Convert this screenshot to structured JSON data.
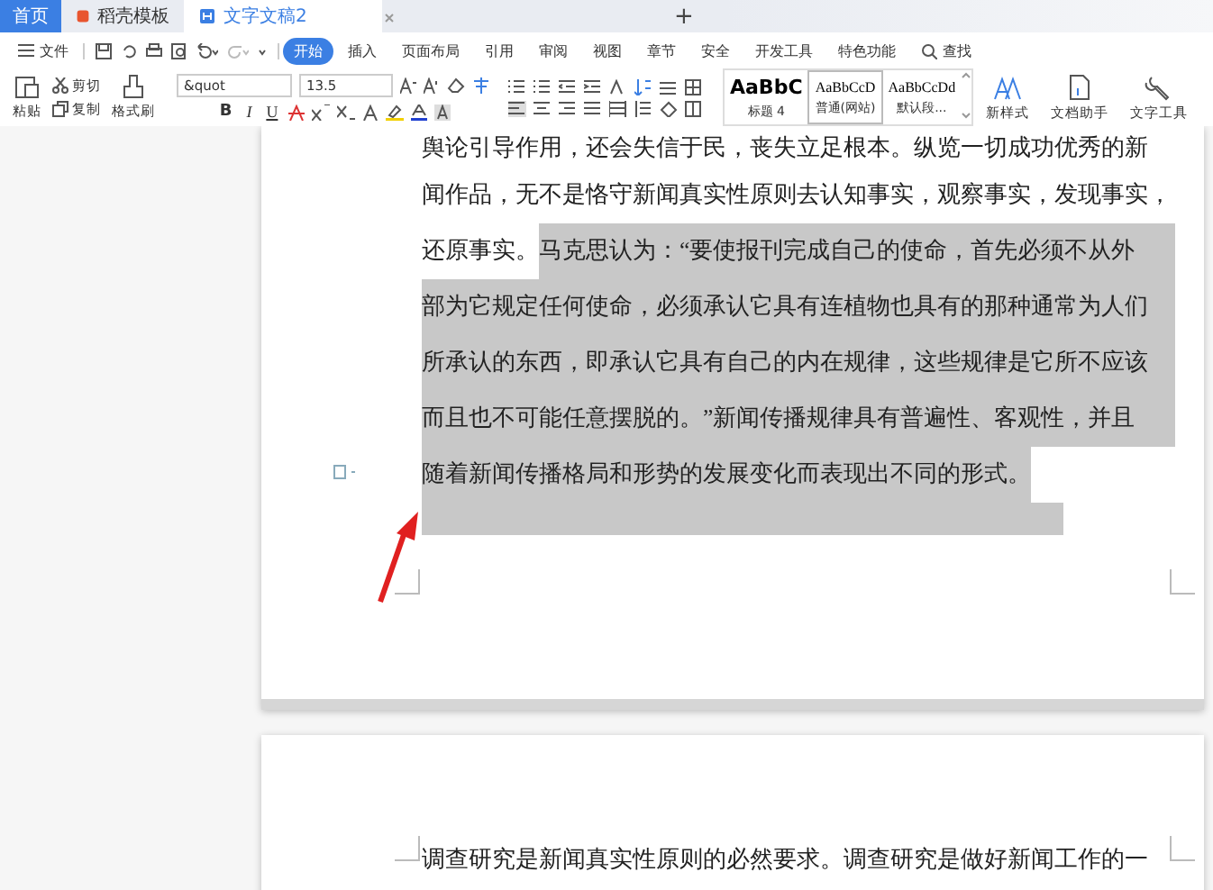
{
  "tabs": [
    {
      "label": "首页",
      "kind": "home",
      "selected": false
    },
    {
      "label": "稻壳模板",
      "kind": "template",
      "selected": false
    },
    {
      "label": "文字文稿2",
      "kind": "document",
      "selected": true
    }
  ],
  "new_tab": "+",
  "menu": [
    {
      "label": "文件",
      "kind": "file",
      "selected": false
    },
    {
      "label": "开始",
      "kind": "tab",
      "selected": true
    },
    {
      "label": "插入",
      "kind": "tab",
      "selected": false
    },
    {
      "label": "页面布局",
      "kind": "tab",
      "selected": false
    },
    {
      "label": "引用",
      "kind": "tab",
      "selected": false
    },
    {
      "label": "审阅",
      "kind": "tab",
      "selected": false
    },
    {
      "label": "视图",
      "kind": "tab",
      "selected": false
    },
    {
      "label": "章节",
      "kind": "tab",
      "selected": false
    },
    {
      "label": "安全",
      "kind": "tab",
      "selected": false
    },
    {
      "label": "开发工具",
      "kind": "tab",
      "selected": false
    },
    {
      "label": "特色功能",
      "kind": "tab",
      "selected": false
    },
    {
      "label": "查找",
      "kind": "search",
      "selected": false
    }
  ],
  "clipboard": {
    "paste": "粘贴",
    "cut": "剪切",
    "copy": "复制",
    "format_painter": "格式刷"
  },
  "font": {
    "name": "&quot",
    "size": "13.5",
    "bold": "B",
    "italic": "I",
    "underline": "U"
  },
  "styles": [
    {
      "sample": "AaBbC",
      "label": "标题 4",
      "kind": "heading"
    },
    {
      "sample": "AaBbCcD",
      "label": "普通(网站)",
      "kind": "normal"
    },
    {
      "sample": "AaBbCcDd",
      "label": "默认段...",
      "kind": "default"
    }
  ],
  "tools": [
    {
      "label": "新样式",
      "kind": "new-style"
    },
    {
      "label": "文档助手",
      "kind": "assistant"
    },
    {
      "label": "文字工具",
      "kind": "text-tools"
    }
  ],
  "page_1": {
    "lines": [
      {
        "segments": [
          {
            "text": "舆论引导作用，还会失信于民，丧失立足根本。纵览一切成功优秀的新",
            "selected": false
          }
        ]
      },
      {
        "segments": [
          {
            "text": "闻作品，无不是恪守新闻真实性原则去认知事实，观察事实，发现事实，",
            "selected": false
          }
        ]
      },
      {
        "segments": [
          {
            "text": "还原事实。",
            "selected": false
          },
          {
            "text": "马克思认为：“要使报刊完成自己的使命，首先必须不从外",
            "selected": true
          }
        ]
      },
      {
        "segments": [
          {
            "text": "部为它规定任何使命，必须承认它具有连植物也具有的那种通常为人们",
            "selected": true
          }
        ]
      },
      {
        "segments": [
          {
            "text": "所承认的东西，即承认它具有自己的内在规律，这些规律是它所不应该",
            "selected": true
          }
        ]
      },
      {
        "segments": [
          {
            "text": "而且也不可能任意摆脱的。”新闻传播规律具有普遍性、客观性，并且",
            "selected": true
          }
        ]
      },
      {
        "segments": [
          {
            "text": "随着新闻传播格局和形势的发展变化而表现出不同的形式。",
            "selected": true
          }
        ]
      }
    ],
    "trailing_selected": true
  },
  "page_2": {
    "lines": [
      {
        "segments": [
          {
            "text": "调查研究是新闻真实性原则的必然要求。调查研究是做好新闻工作的一",
            "selected": false
          }
        ]
      }
    ]
  }
}
